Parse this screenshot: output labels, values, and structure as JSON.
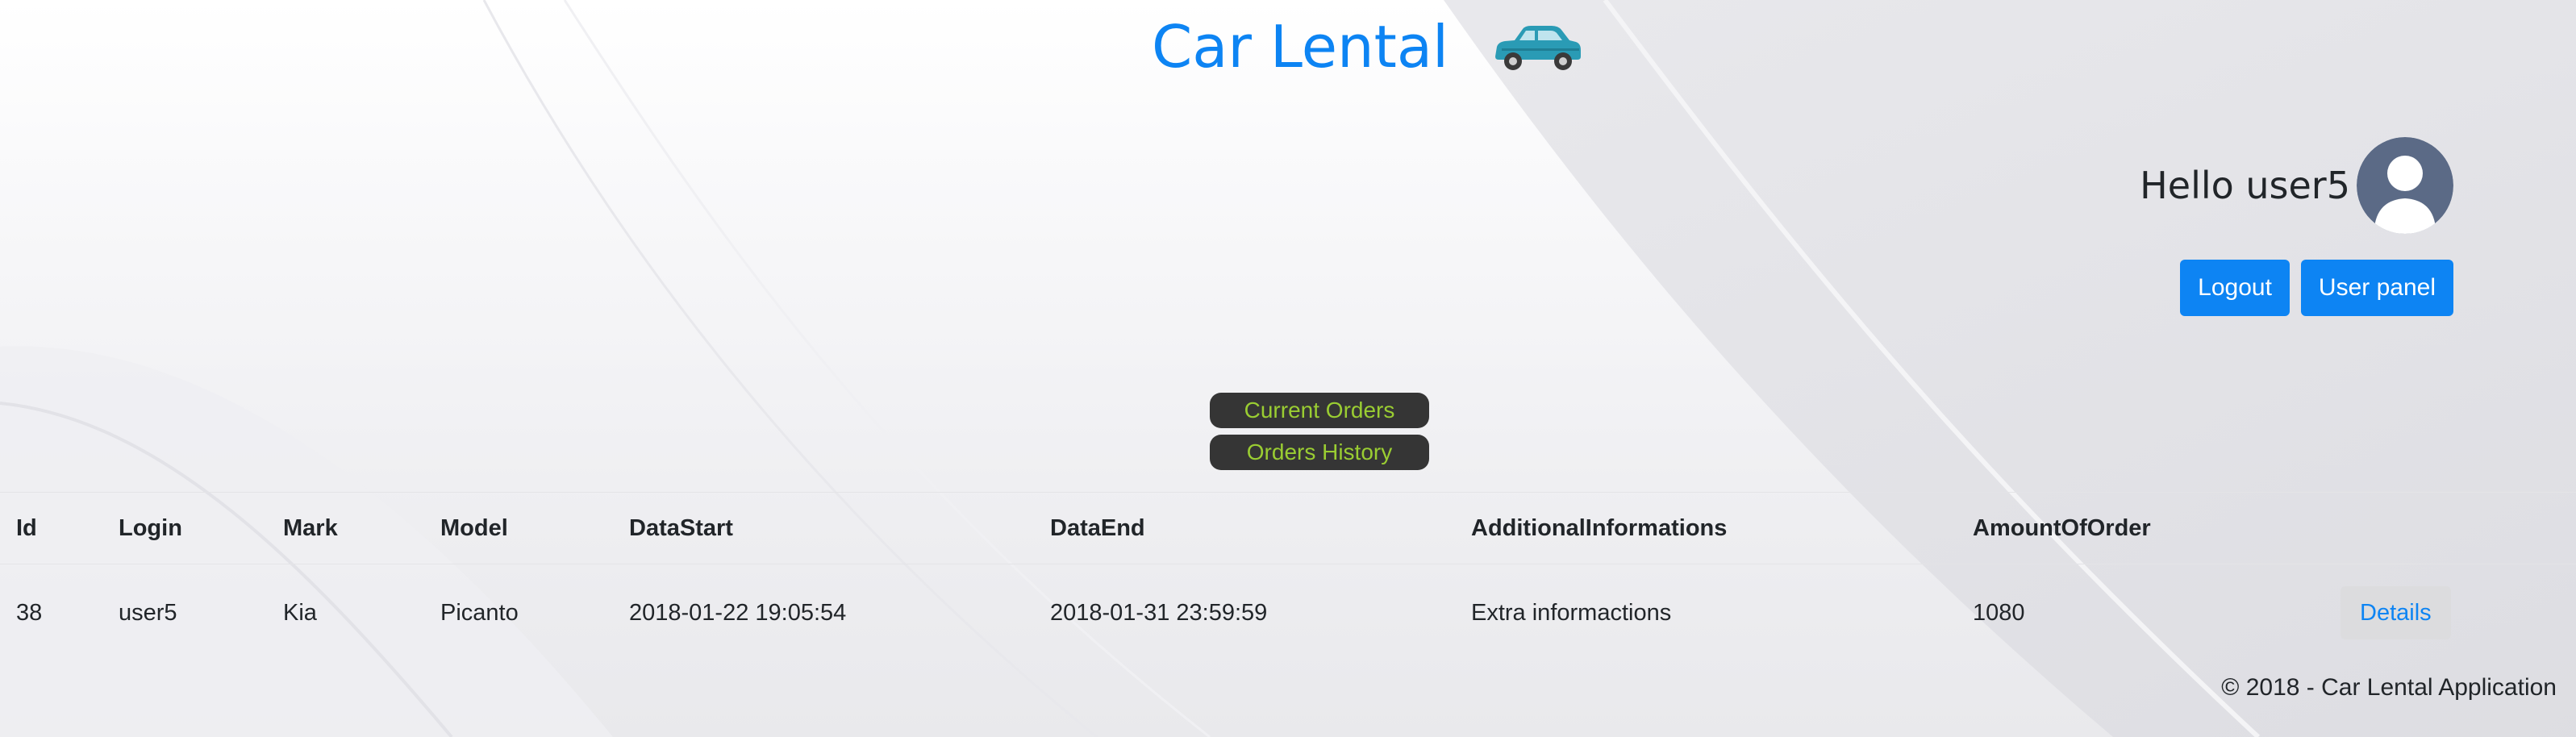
{
  "header": {
    "brand_title": "Car Lental",
    "car_icon": "car-icon"
  },
  "user": {
    "greeting": "Hello user5",
    "avatar_icon": "user-avatar-icon"
  },
  "actions": {
    "logout_label": "Logout",
    "user_panel_label": "User panel"
  },
  "order_tabs": {
    "current_label": "Current Orders",
    "history_label": "Orders History"
  },
  "orders_table": {
    "columns": [
      "Id",
      "Login",
      "Mark",
      "Model",
      "DataStart",
      "DataEnd",
      "AdditionalInformations",
      "AmountOfOrder",
      ""
    ],
    "rows": [
      {
        "id": "38",
        "login": "user5",
        "mark": "Kia",
        "model": "Picanto",
        "data_start": "2018-01-22 19:05:54",
        "data_end": "2018-01-31 23:59:59",
        "additional_info": "Extra informactions",
        "amount": "1080",
        "details_label": "Details"
      }
    ]
  },
  "footer": {
    "copyright": "© 2018 - Car Lental Application"
  },
  "colors": {
    "accent": "#0d84f3",
    "tab_background": "#353535",
    "tab_text": "#9acd32",
    "text": "#212529"
  }
}
